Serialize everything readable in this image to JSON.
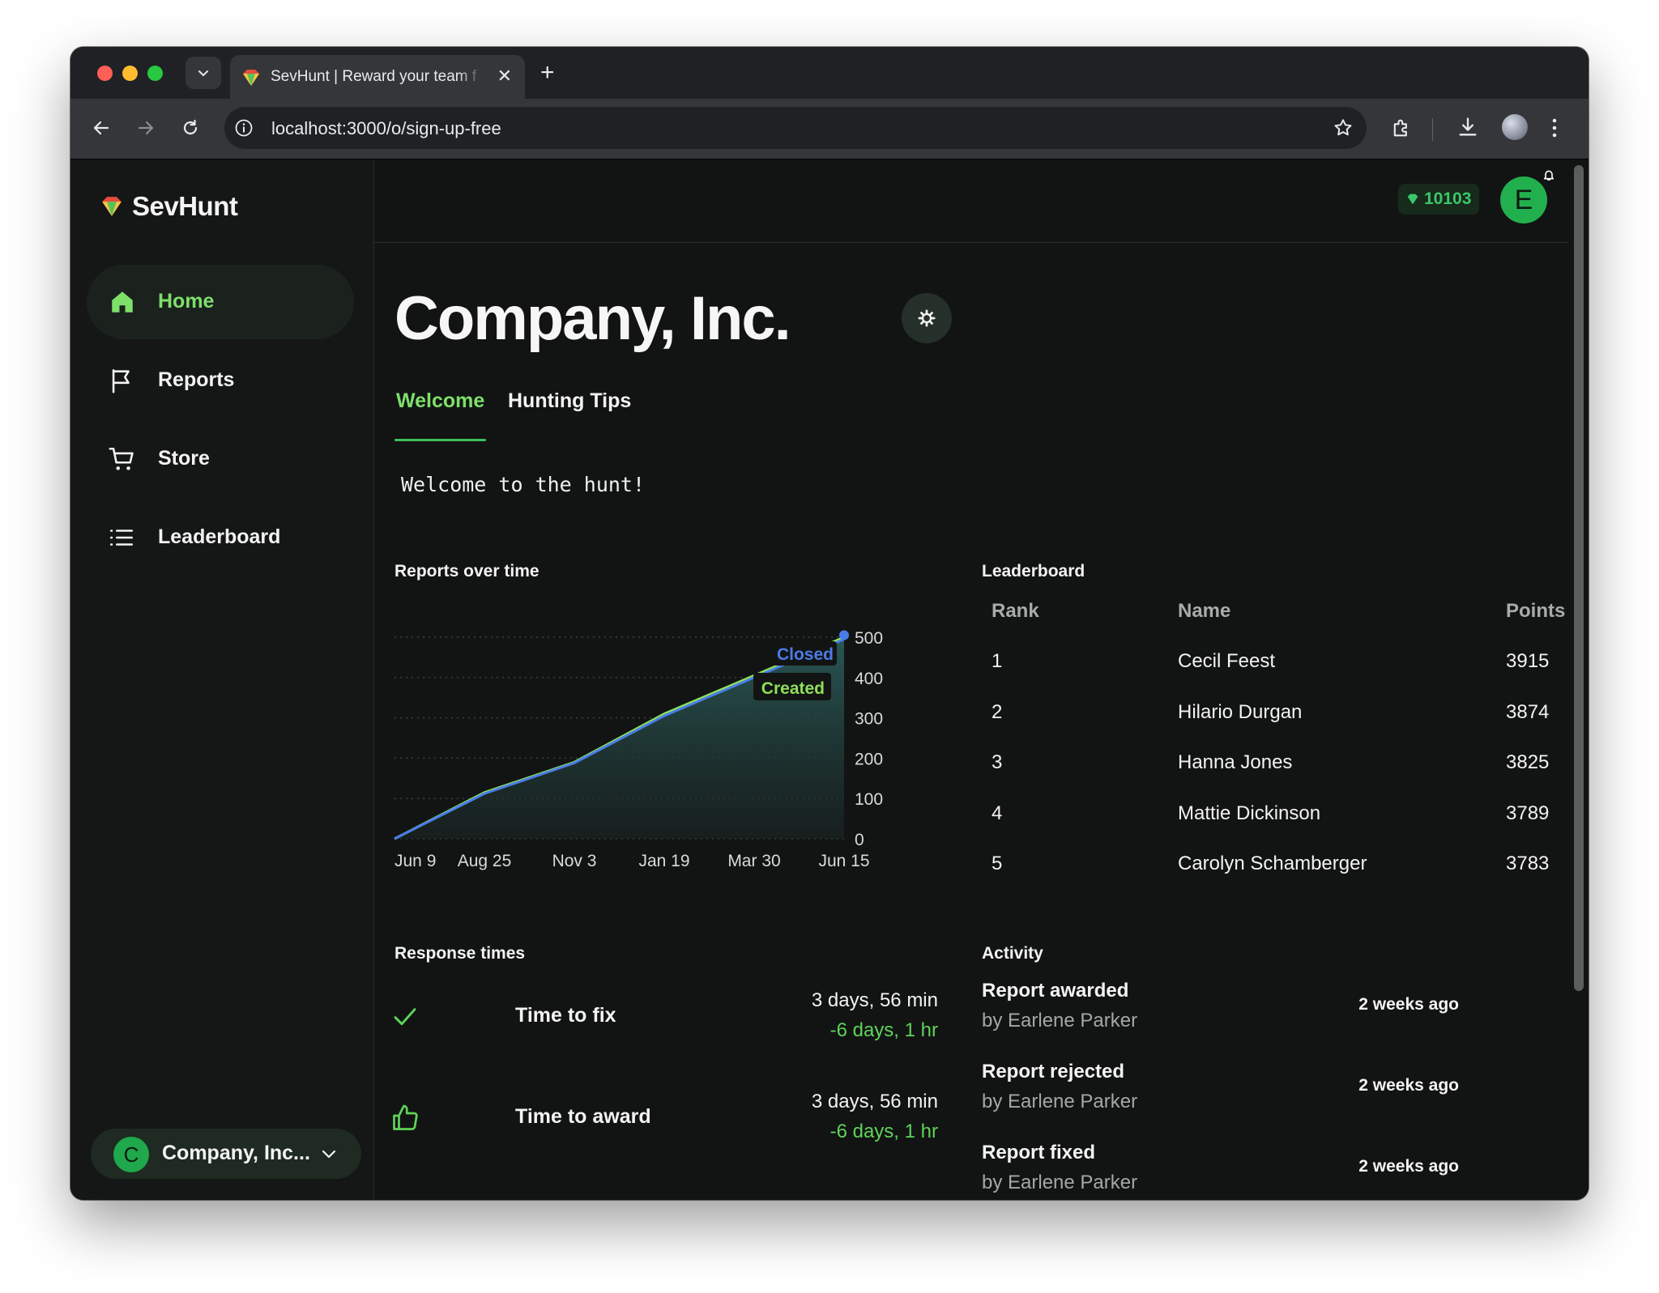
{
  "browser": {
    "tab_title": "SevHunt | Reward your team f",
    "url": "localhost:3000/o/sign-up-free"
  },
  "sidebar": {
    "brand": "SevHunt",
    "items": [
      {
        "label": "Home",
        "icon": "home-icon",
        "active": true
      },
      {
        "label": "Reports",
        "icon": "flag-icon",
        "active": false
      },
      {
        "label": "Store",
        "icon": "cart-icon",
        "active": false
      },
      {
        "label": "Leaderboard",
        "icon": "list-icon",
        "active": false
      }
    ],
    "org": {
      "avatar_letter": "C",
      "name": "Company, Inc..."
    }
  },
  "topbar": {
    "points": "10103",
    "user_initial": "E"
  },
  "main": {
    "title": "Company, Inc.",
    "tabs": [
      {
        "label": "Welcome",
        "active": true
      },
      {
        "label": "Hunting Tips",
        "active": false
      }
    ],
    "welcome_text": "Welcome to the hunt!"
  },
  "reports_chart": {
    "section_title": "Reports over time"
  },
  "chart_data": {
    "type": "area",
    "x_tick_labels": [
      "Jun 9",
      "Aug 25",
      "Nov 3",
      "Jan 19",
      "Mar 30",
      "Jun 15"
    ],
    "ylim": [
      0,
      500
    ],
    "y_ticks": [
      0,
      100,
      200,
      300,
      400,
      500
    ],
    "grid": true,
    "series": [
      {
        "name": "Created",
        "color": "#8ee05a",
        "x": [
          "Jun 9",
          "Aug 25",
          "Nov 3",
          "Jan 19",
          "Mar 30",
          "Jun 15"
        ],
        "values": [
          0,
          115,
          190,
          310,
          405,
          500
        ]
      },
      {
        "name": "Closed",
        "color": "#4a7ce8",
        "x": [
          "Jun 9",
          "Aug 25",
          "Nov 3",
          "Jan 19",
          "Mar 30",
          "Jun 15"
        ],
        "values": [
          0,
          112,
          188,
          305,
          400,
          495
        ]
      }
    ]
  },
  "leaderboard": {
    "section_title": "Leaderboard",
    "headers": {
      "rank": "Rank",
      "name": "Name",
      "points": "Points"
    },
    "rows": [
      {
        "rank": "1",
        "name": "Cecil Feest",
        "points": "3915"
      },
      {
        "rank": "2",
        "name": "Hilario Durgan",
        "points": "3874"
      },
      {
        "rank": "3",
        "name": "Hanna Jones",
        "points": "3825"
      },
      {
        "rank": "4",
        "name": "Mattie Dickinson",
        "points": "3789"
      },
      {
        "rank": "5",
        "name": "Carolyn Schamberger",
        "points": "3783"
      }
    ]
  },
  "response_times": {
    "section_title": "Response times",
    "items": [
      {
        "label": "Time to fix",
        "icon": "check-icon",
        "value": "3 days, 56 min",
        "delta": "-6 days, 1 hr"
      },
      {
        "label": "Time to award",
        "icon": "thumbs-up-icon",
        "value": "3 days, 56 min",
        "delta": "-6 days, 1 hr"
      }
    ]
  },
  "activity": {
    "section_title": "Activity",
    "items": [
      {
        "title": "Report awarded",
        "by": "by Earlene Parker",
        "time": "2 weeks ago"
      },
      {
        "title": "Report rejected",
        "by": "by Earlene Parker",
        "time": "2 weeks ago"
      },
      {
        "title": "Report fixed",
        "by": "by Earlene Parker",
        "time": "2 weeks ago"
      }
    ]
  },
  "colors": {
    "accent": "#7ee06a",
    "brand_green": "#22b04f",
    "background": "#121413",
    "closed_blue": "#4a7ce8"
  }
}
